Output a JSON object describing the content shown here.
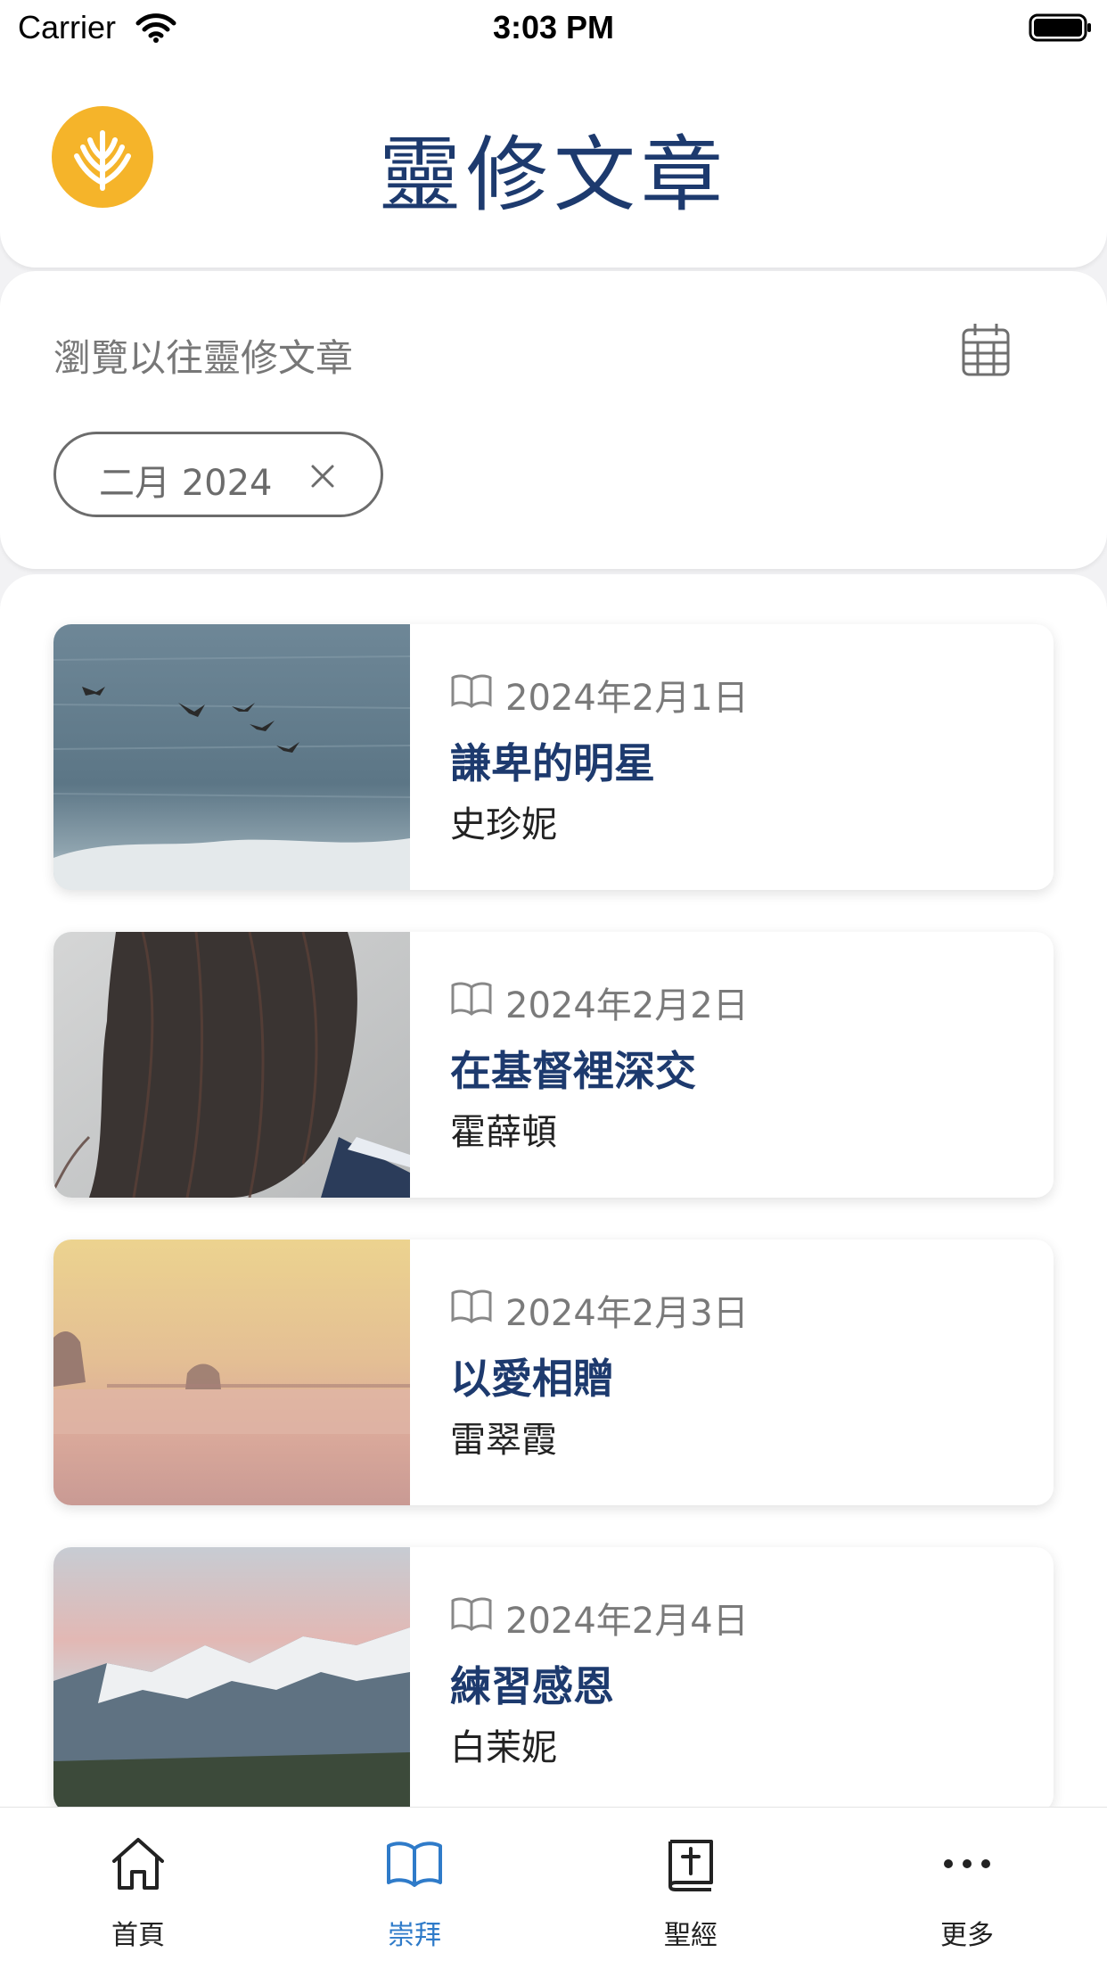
{
  "status_bar": {
    "carrier": "Carrier",
    "time": "3:03 PM"
  },
  "header": {
    "title": "靈修文章",
    "logo": "wheat-logo-icon"
  },
  "filter": {
    "browse_label": "瀏覽以往靈修文章",
    "calendar_icon": "calendar-icon",
    "chip_label": "二月 2024",
    "chip_close_icon": "close-icon"
  },
  "articles": [
    {
      "date": "2024年2月1日",
      "title": "謙卑的明星",
      "author": "史珍妮",
      "image": "ocean-birds"
    },
    {
      "date": "2024年2月2日",
      "title": "在基督裡深交",
      "author": "霍薛頓",
      "image": "hair-back-of-head"
    },
    {
      "date": "2024年2月3日",
      "title": "以愛相贈",
      "author": "雷翠霞",
      "image": "misty-field"
    },
    {
      "date": "2024年2月4日",
      "title": "練習感恩",
      "author": "白茉妮",
      "image": "snowy-mountains"
    }
  ],
  "tabbar": {
    "items": [
      {
        "label": "首頁",
        "icon": "home-icon",
        "active": false
      },
      {
        "label": "崇拜",
        "icon": "open-book-icon",
        "active": true
      },
      {
        "label": "聖經",
        "icon": "bible-icon",
        "active": false
      },
      {
        "label": "更多",
        "icon": "more-icon",
        "active": false
      }
    ]
  },
  "colors": {
    "title_blue": "#1d3a6e",
    "active_tab": "#2f7bc9",
    "logo_orange": "#f5b42a",
    "background": "#f2f2f4"
  }
}
